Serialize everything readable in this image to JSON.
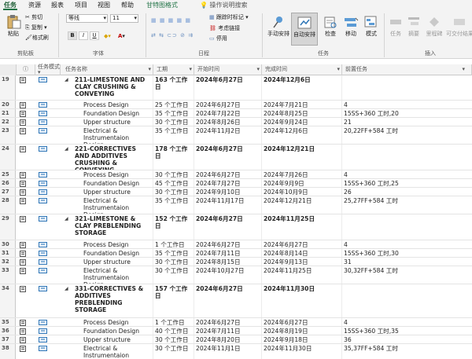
{
  "tabs": [
    "任务",
    "资源",
    "报表",
    "项目",
    "视图",
    "帮助",
    "甘特图格式"
  ],
  "search_label": "操作说明搜索",
  "ribbon": {
    "paste": "粘贴",
    "cut": "剪切",
    "copy": "复制",
    "format_painter": "格式刷",
    "font_name": "等线",
    "font_size": "11",
    "bold": "B",
    "italic": "I",
    "underline": "U",
    "follow_link": "跟踪时标记",
    "respect_links": "考虑链接",
    "deactivate": "停用",
    "manual": "手动安排",
    "auto": "自动安排",
    "inspect": "检查",
    "move": "移动",
    "mode": "模式",
    "task": "任务",
    "summary": "摘要",
    "milestone": "里程碑",
    "deliverable": "可交付结果",
    "groups": {
      "clipboard": "剪贴板",
      "font": "字体",
      "schedule": "日程",
      "tasks": "任务",
      "insert": "插入"
    }
  },
  "columns": {
    "mode": "任务模式",
    "name": "任务名称",
    "duration": "工期",
    "start": "开始时间",
    "finish": "完成时间",
    "pred": "前置任务"
  },
  "rows": [
    {
      "id": "19",
      "summary": true,
      "name": "211-LIMESTONE AND CLAY CRUSHING & CONVEYING",
      "duration": "163 个工作日",
      "start": "2024年6月27日",
      "finish": "2024年12月6日",
      "pred": ""
    },
    {
      "id": "20",
      "name": "Process Design",
      "duration": "25 个工作日",
      "start": "2024年6月27日",
      "finish": "2024年7月21日",
      "pred": "4"
    },
    {
      "id": "21",
      "name": "Foundation Design",
      "duration": "35 个工作日",
      "start": "2024年7月22日",
      "finish": "2024年8月25日",
      "pred": "15SS+360 工时,20"
    },
    {
      "id": "22",
      "name": "Upper structure Design",
      "duration": "30 个工作日",
      "start": "2024年8月26日",
      "finish": "2024年9月24日",
      "pred": "21"
    },
    {
      "id": "23",
      "name": "Electrical & Instrumentaion Design",
      "duration": "35 个工作日",
      "start": "2024年11月2日",
      "finish": "2024年12月6日",
      "pred": "20,22FF+584 工时"
    },
    {
      "id": "24",
      "summary": true,
      "name": "221-CORRECTIVES AND ADDITIVES CRUSHING & CONVEYING",
      "duration": "178 个工作日",
      "start": "2024年6月27日",
      "finish": "2024年12月21日",
      "pred": ""
    },
    {
      "id": "25",
      "name": "Process Design",
      "duration": "30 个工作日",
      "start": "2024年6月27日",
      "finish": "2024年7月26日",
      "pred": "4"
    },
    {
      "id": "26",
      "name": "Foundation Design",
      "duration": "45 个工作日",
      "start": "2024年7月27日",
      "finish": "2024年9月9日",
      "pred": "15SS+360 工时,25"
    },
    {
      "id": "27",
      "name": "Upper structure Design",
      "duration": "30 个工作日",
      "start": "2024年9月10日",
      "finish": "2024年10月9日",
      "pred": "26"
    },
    {
      "id": "28",
      "name": "Electrical & Instrumentaion Design",
      "duration": "35 个工作日",
      "start": "2024年11月17日",
      "finish": "2024年12月21日",
      "pred": "25,27FF+584 工时"
    },
    {
      "id": "29",
      "summary": true,
      "name": "321-LIMESTONE & CLAY PREBLENDING STORAGE",
      "duration": "152 个工作日",
      "start": "2024年6月27日",
      "finish": "2024年11月25日",
      "pred": ""
    },
    {
      "id": "30",
      "name": "Process Design",
      "duration": "1 个工作日",
      "start": "2024年6月27日",
      "finish": "2024年6月27日",
      "pred": "4"
    },
    {
      "id": "31",
      "name": "Foundation Design",
      "duration": "35 个工作日",
      "start": "2024年7月11日",
      "finish": "2024年8月14日",
      "pred": "15SS+360 工时,30"
    },
    {
      "id": "32",
      "name": "Upper structure Design",
      "duration": "30 个工作日",
      "start": "2024年8月15日",
      "finish": "2024年9月13日",
      "pred": "31"
    },
    {
      "id": "33",
      "name": "Electrical & Instrumentaion Design",
      "duration": "30 个工作日",
      "start": "2024年10月27日",
      "finish": "2024年11月25日",
      "pred": "30,32FF+584 工时"
    },
    {
      "id": "34",
      "summary": true,
      "name": "331-CORRECTIVES & ADDITIVES PREBLENDING STORAGE",
      "duration": "157 个工作日",
      "start": "2024年6月27日",
      "finish": "2024年11月30日",
      "pred": ""
    },
    {
      "id": "35",
      "name": "Process Design",
      "duration": "1 个工作日",
      "start": "2024年6月27日",
      "finish": "2024年6月27日",
      "pred": "4"
    },
    {
      "id": "36",
      "name": "Foundation Design",
      "duration": "40 个工作日",
      "start": "2024年7月11日",
      "finish": "2024年8月19日",
      "pred": "15SS+360 工时,35"
    },
    {
      "id": "37",
      "name": "Upper structure Design",
      "duration": "30 个工作日",
      "start": "2024年8月20日",
      "finish": "2024年9月18日",
      "pred": "36"
    },
    {
      "id": "38",
      "name": "Electrical & Instrumentaion Design",
      "duration": "30 个工作日",
      "start": "2024年11月1日",
      "finish": "2024年11月30日",
      "pred": "35,37FF+584 工时"
    }
  ]
}
